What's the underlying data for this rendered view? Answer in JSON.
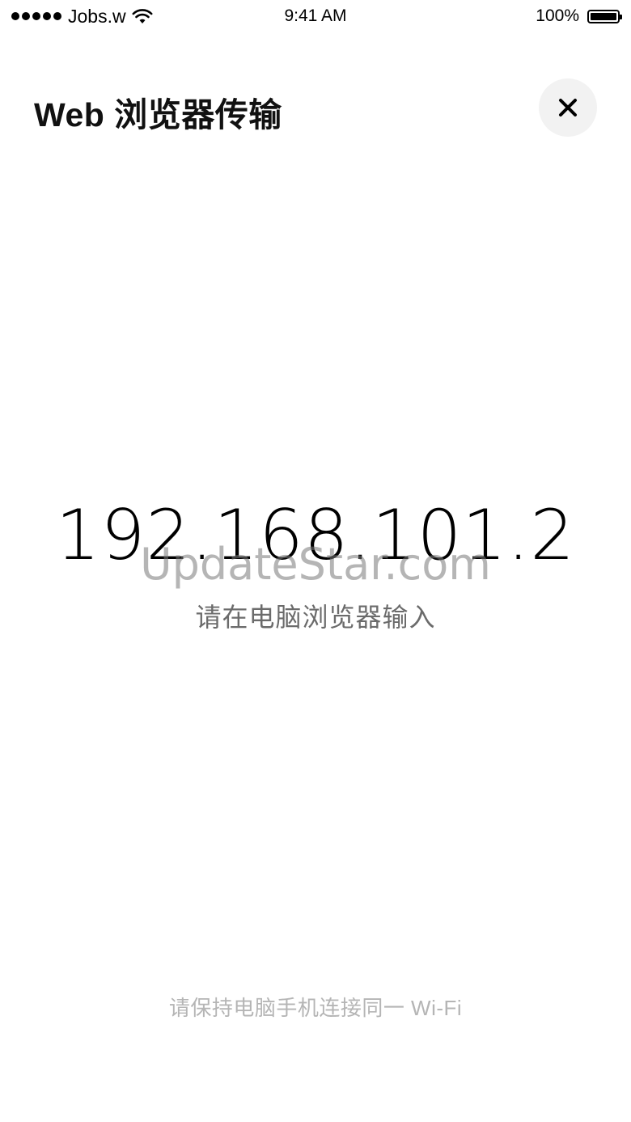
{
  "status_bar": {
    "carrier": "Jobs.w",
    "time": "9:41 AM",
    "battery": "100%",
    "signal_icon": "signal-dots-icon",
    "wifi_icon": "wifi-icon",
    "battery_icon": "battery-icon",
    "battery_level": 1.0
  },
  "header": {
    "title": "Web 浏览器传输",
    "close_icon": "close-icon"
  },
  "main": {
    "ip_address": "192.168.101.2",
    "watermark": "UpdateStar.com",
    "instruction": "请在电脑浏览器输入"
  },
  "footer": {
    "hint": "请保持电脑手机连接同一 Wi-Fi"
  }
}
